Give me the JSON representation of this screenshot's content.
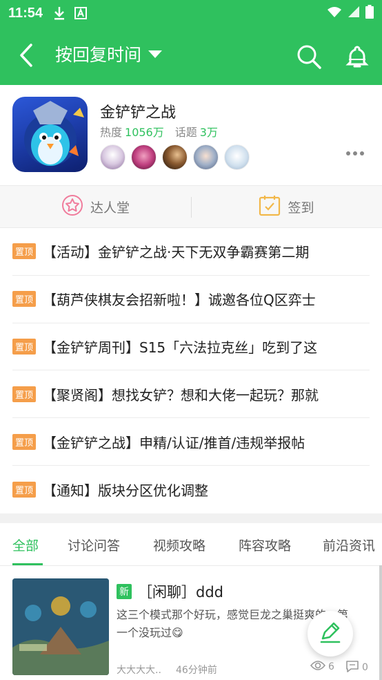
{
  "status_bar": {
    "time": "11:54",
    "download_icon": "download-icon",
    "a_icon": "a-notification-icon",
    "wifi_icon": "wifi-icon",
    "signal_icon": "signal-icon",
    "battery_icon": "battery-icon"
  },
  "app_bar": {
    "sort_label": "按回复时间",
    "back_icon": "back-arrow-icon",
    "dropdown_icon": "triangle-down-icon",
    "search_icon": "search-icon",
    "bell_icon": "bell-icon",
    "background_color": "#2fc15e"
  },
  "forum": {
    "name": "金铲铲之战",
    "heat_label": "热度",
    "heat_value": "1056万",
    "topics_label": "话题",
    "topics_value": "3万",
    "more_icon": "more-dots-icon"
  },
  "quick_actions": [
    {
      "label": "达人堂",
      "icon": "star-badge-icon"
    },
    {
      "label": "签到",
      "icon": "calendar-check-icon"
    }
  ],
  "pinned_tag": "置顶",
  "pinned": [
    {
      "title": "【活动】金铲铲之战·天下无双争霸赛第二期"
    },
    {
      "title": "【葫芦侠棋友会招新啦！】诚邀各位Q区弈士"
    },
    {
      "title": "【金铲铲周刊】S15「六法拉克丝」吃到了这"
    },
    {
      "title": "【聚贤阁】想找女铲？想和大佬一起玩？那就"
    },
    {
      "title": "【金铲铲之战】申精/认证/推首/违规举报帖"
    },
    {
      "title": "【通知】版块分区优化调整"
    }
  ],
  "tabs": [
    {
      "label": "全部",
      "active": true
    },
    {
      "label": "讨论问答"
    },
    {
      "label": "视频攻略"
    },
    {
      "label": "阵容攻略"
    },
    {
      "label": "前沿资讯"
    }
  ],
  "feed": [
    {
      "new_tag": "新",
      "title": "［闲聊］ddd",
      "excerpt": "这三个模式那个好玩，感觉巨龙之巢挺爽的，第一个没玩过😋",
      "author": "大大大大..",
      "time": "46分钟前",
      "views": "6",
      "comments": "0"
    }
  ],
  "fab": {
    "icon": "edit-pencil-icon"
  }
}
